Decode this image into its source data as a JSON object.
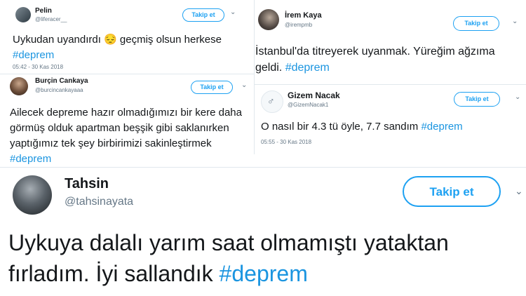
{
  "tweets": [
    {
      "name": "Pelin",
      "handle": "@liferacer__",
      "follow_label": "Takip et",
      "text": "Uykudan uyandırdı 😔 geçmiş olsun herkese ",
      "hashtag": "#deprem",
      "timestamp": "05:42 - 30 Kas 2018"
    },
    {
      "name": "Burçin Cankaya",
      "handle": "@burcincankayaaa",
      "follow_label": "Takip et",
      "text": "Ailecek depreme hazır olmadığımızı bir kere daha görmüş olduk apartman beşşik gibi saklanırken yaptığımız tek şey birbirimizi sakinleştirmek ",
      "hashtag": "#deprem"
    },
    {
      "name": "İrem Kaya",
      "handle": "@irempmb",
      "follow_label": "Takip et",
      "text": "İstanbul'da titreyerek uyanmak. Yüreğim ağzıma geldi. ",
      "hashtag": "#deprem"
    },
    {
      "name": "Gizem Nacak",
      "handle": "@GizemNacak1",
      "follow_label": "Takip et",
      "text": "O nasıl bir 4.3 tü öyle, 7.7 sandım ",
      "hashtag": "#deprem",
      "timestamp": "05:55 - 30 Kas 2018"
    },
    {
      "name": "Tahsin",
      "handle": "@tahsinayata",
      "follow_label": "Takip et",
      "text": "Uykuya dalalı yarım saat olmamıştı yataktan fırladım. İyi sallandık ",
      "hashtag": "#deprem"
    }
  ],
  "icons": {
    "chevron": "chevron-down-icon",
    "default_avatar": "egg-avatar-icon"
  },
  "colors": {
    "accent": "#1da1f2",
    "hashtag": "#1b95e0",
    "muted": "#657786",
    "divider": "#e1e8ed"
  }
}
